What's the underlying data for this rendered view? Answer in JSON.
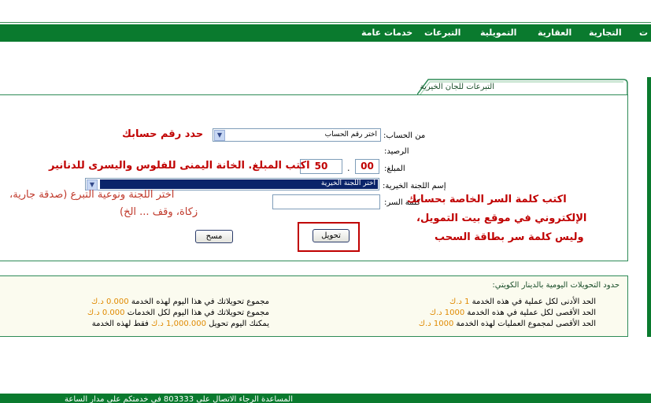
{
  "nav": {
    "items": [
      "التجارية",
      "العقارية",
      "التمويلية",
      "التبرعات",
      "خدمات عامة"
    ],
    "edge_item": "ت"
  },
  "panel": {
    "title": "التبرعات للجان الخيرية",
    "account_label": "من الحساب:",
    "account_placeholder": "اختر رقم الحساب",
    "balance_label": "الرصيد:",
    "amount_label": "المبلغ:",
    "amount_dinars": "50",
    "amount_fils": "00",
    "amount_separator": ".",
    "committee_label": "إسم اللجنة الخيرية:",
    "committee_placeholder": "اختر اللجنة الخيرية",
    "password_label": "كلمة السر:",
    "password_value": "",
    "transfer_button": "تحويل",
    "clear_button": "مسح"
  },
  "annotations": {
    "account": "حدد رقم حسابك",
    "amount": "اكتب المبلغ. الخانة اليمنى للفلوس واليسرى للدنانير",
    "committee_line1": "اختر اللجنة ونوعية التبرع (صدقة جارية،",
    "committee_line2": "زكاة، وقف ... الخ)",
    "password_line1": "اكتب كلمة السر الخاصة بحسابك",
    "password_line2": "الإلكتروني في موقع بيت التمويل،",
    "password_line3": "وليس كلمة سر بطاقة السحب"
  },
  "limits": {
    "title": "حدود التحويلات اليومية بالدينار الكويتي:",
    "right": [
      {
        "text": "الحد الأدنى لكل عملية في هذه الخدمة",
        "value": "1 د.ك"
      },
      {
        "text": "الحد الأقصى لكل عملية في هذه الخدمة",
        "value": "1000 د.ك"
      },
      {
        "text": "الحد الأقصى لمجموع العمليات لهذه الخدمة",
        "value": "1000 د.ك"
      }
    ],
    "left": [
      {
        "text": "مجموع تحويلاتك في هذا اليوم لهذه الخدمة",
        "value": "0.000 د.ك",
        "suffix": ""
      },
      {
        "text": "مجموع تحويلاتك في هذا اليوم لكل الخدمات",
        "value": "0.000 د.ك",
        "suffix": ""
      },
      {
        "text": "يمكنك اليوم تحويل",
        "value": "1,000.000 د.ك",
        "suffix": "فقط لهذه الخدمة"
      }
    ]
  },
  "footer": {
    "text": "المساعدة الرجاء الاتصال على 803333 في خدمتكم على مدار الساعة"
  },
  "colors": {
    "brand_green": "#0a7a2e",
    "annotation_red": "#c00000",
    "highlight_orange": "#e08a00",
    "selection_blue": "#0a246a"
  }
}
